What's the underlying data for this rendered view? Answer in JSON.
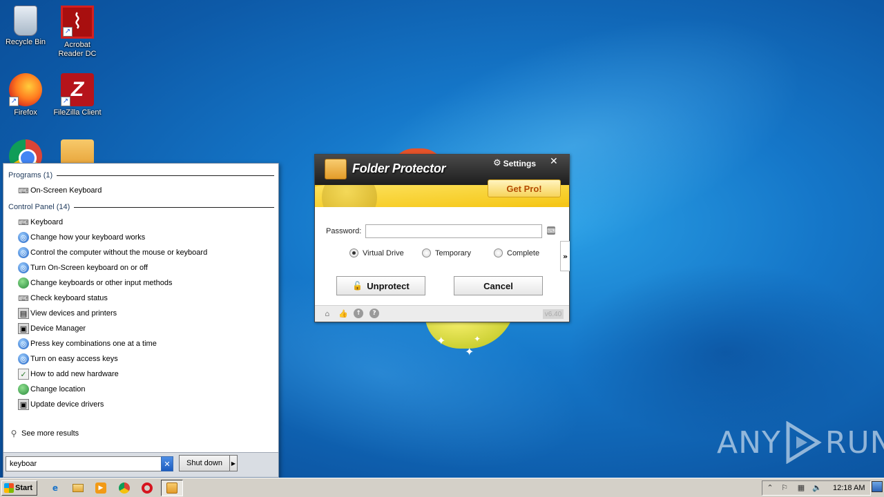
{
  "desktop": {
    "icons": [
      {
        "label": "Recycle Bin",
        "icon": "recycle-bin-icon"
      },
      {
        "label": "Acrobat Reader DC",
        "icon": "acrobat-reader-icon"
      },
      {
        "label": "Firefox",
        "icon": "firefox-icon"
      },
      {
        "label": "FileZilla Client",
        "icon": "filezilla-icon"
      },
      {
        "label": "",
        "icon": "chrome-icon"
      },
      {
        "label": "",
        "icon": "folder-protector-icon"
      }
    ],
    "watermark": {
      "left": "ANY",
      "right": "RUN"
    }
  },
  "start_menu": {
    "programs_header": "Programs (1)",
    "programs": [
      {
        "label": "On-Screen Keyboard",
        "icon": "keyboard-icon"
      }
    ],
    "control_panel_header": "Control Panel (14)",
    "control_panel": [
      {
        "label": "Keyboard",
        "icon": "keyboard-icon"
      },
      {
        "label": "Change how your keyboard works",
        "icon": "ease-of-access-icon"
      },
      {
        "label": "Control the computer without the mouse or keyboard",
        "icon": "ease-of-access-icon"
      },
      {
        "label": "Turn On-Screen keyboard on or off",
        "icon": "ease-of-access-icon"
      },
      {
        "label": "Change keyboards or other input methods",
        "icon": "region-globe-icon"
      },
      {
        "label": "Check keyboard status",
        "icon": "keyboard-icon"
      },
      {
        "label": "View devices and printers",
        "icon": "devices-printers-icon"
      },
      {
        "label": "Device Manager",
        "icon": "device-manager-icon"
      },
      {
        "label": "Press key combinations one at a time",
        "icon": "ease-of-access-icon"
      },
      {
        "label": "Turn on easy access keys",
        "icon": "ease-of-access-icon"
      },
      {
        "label": "How to add new hardware",
        "icon": "add-hardware-icon"
      },
      {
        "label": "Change location",
        "icon": "region-globe-icon"
      },
      {
        "label": "Update device drivers",
        "icon": "device-manager-icon"
      }
    ],
    "see_more": "See more results",
    "search_value": "keyboar",
    "shutdown_label": "Shut down"
  },
  "folder_protector": {
    "title": "Folder Protector",
    "settings_label": "Settings",
    "get_pro_label": "Get Pro!",
    "password_label": "Password:",
    "password_value": "",
    "modes": [
      {
        "label": "Virtual Drive",
        "selected": true
      },
      {
        "label": "Temporary",
        "selected": false
      },
      {
        "label": "Complete",
        "selected": false
      }
    ],
    "expand_label": "»",
    "unprotect_label": "Unprotect",
    "cancel_label": "Cancel",
    "version": "v6.40",
    "colors": {
      "header_dark": "#2b2b2b",
      "header_yellow": "#f5c518",
      "get_pro_text": "#b44a00"
    }
  },
  "taskbar": {
    "start_label": "Start",
    "pinned": [
      "internet-explorer-icon",
      "explorer-icon",
      "media-player-icon",
      "chrome-icon",
      "opera-icon",
      "folder-protector-icon"
    ],
    "clock": "12:18 AM"
  }
}
